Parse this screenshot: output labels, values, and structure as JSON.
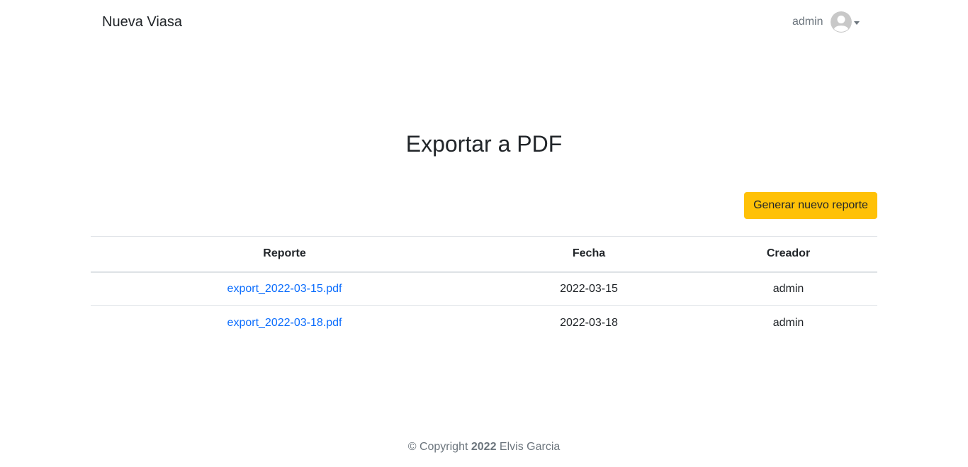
{
  "navbar": {
    "brand": "Nueva Viasa",
    "user": {
      "name": "admin",
      "avatar_icon": "user-avatar-icon"
    }
  },
  "page": {
    "title": "Exportar a PDF",
    "generate_button": "Generar nuevo reporte"
  },
  "table": {
    "headers": [
      "Reporte",
      "Fecha",
      "Creador"
    ],
    "rows": [
      {
        "reporte": "export_2022-03-15.pdf",
        "fecha": "2022-03-15",
        "creador": "admin"
      },
      {
        "reporte": "export_2022-03-18.pdf",
        "fecha": "2022-03-18",
        "creador": "admin"
      }
    ]
  },
  "footer": {
    "prefix": "© Copyright",
    "year": "2022",
    "author": "Elvis Garcia"
  },
  "colors": {
    "accent_button": "#ffc107",
    "link": "#0d6efd",
    "muted_text": "#6c757d"
  }
}
